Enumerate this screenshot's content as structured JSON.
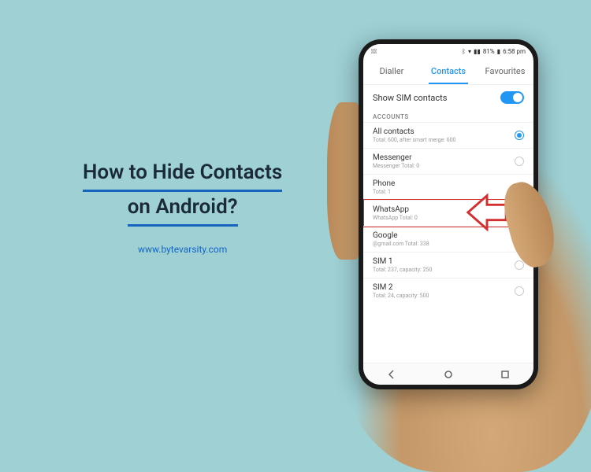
{
  "title": {
    "line1": "How to Hide Contacts",
    "line2": "on Android?"
  },
  "website": "www.bytevarsity.com",
  "status_bar": {
    "eye_icon": "eye-off",
    "signal": "signal",
    "battery_pct": "81%",
    "time": "6:58 pm"
  },
  "tabs": [
    {
      "label": "Dialler",
      "active": false
    },
    {
      "label": "Contacts",
      "active": true
    },
    {
      "label": "Favourites",
      "active": false
    }
  ],
  "sim_toggle": {
    "label": "Show SIM contacts",
    "on": true
  },
  "accounts_header": "ACCOUNTS",
  "accounts": [
    {
      "name": "All contacts",
      "sub": "Total: 600, after smart merge: 600",
      "selected": true,
      "highlighted": false
    },
    {
      "name": "Messenger",
      "sub": "Messenger\nTotal: 0",
      "selected": false,
      "highlighted": false
    },
    {
      "name": "Phone",
      "sub": "Total: 1",
      "selected": false,
      "highlighted": false
    },
    {
      "name": "WhatsApp",
      "sub": "WhatsApp\nTotal: 0",
      "selected": false,
      "highlighted": true
    },
    {
      "name": "Google",
      "sub": "@gmail.com\nTotal: 338",
      "selected": false,
      "highlighted": false
    },
    {
      "name": "SIM 1",
      "sub": "Total: 237, capacity: 250",
      "selected": false,
      "highlighted": false
    },
    {
      "name": "SIM 2",
      "sub": "Total: 24, capacity: 500",
      "selected": false,
      "highlighted": false
    }
  ]
}
